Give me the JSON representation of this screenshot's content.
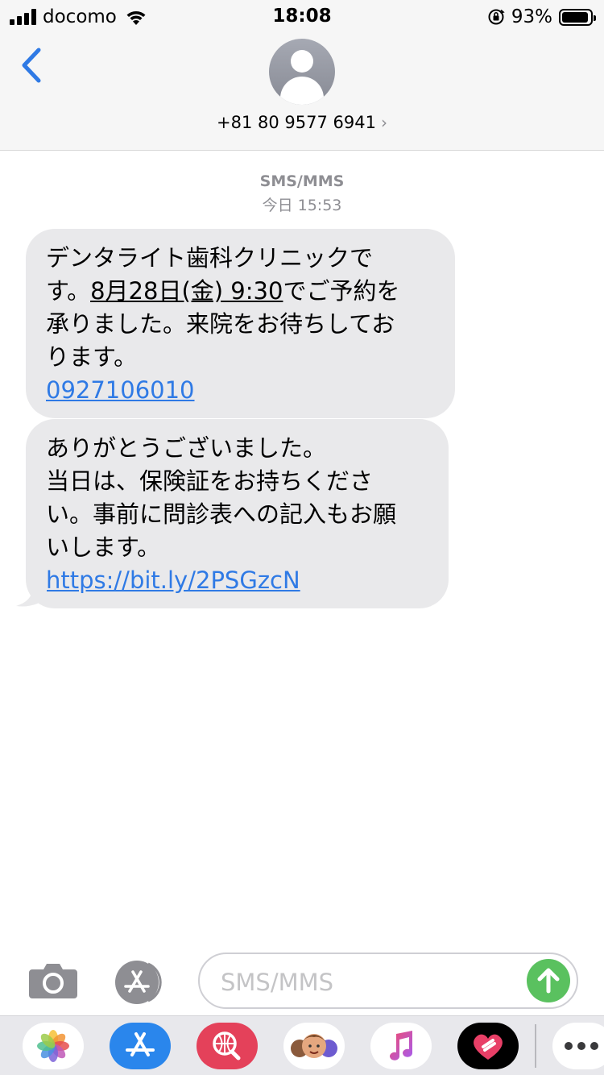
{
  "status": {
    "carrier": "docomo",
    "time": "18:08",
    "battery": "93%",
    "battery_level": 0.93
  },
  "header": {
    "contact": "+81 80 9577 6941",
    "chevron": "›"
  },
  "thread": {
    "service": "SMS/MMS",
    "timestamp": "今日 15:53"
  },
  "messages": [
    {
      "lines": [
        "デンタライト歯科クリニックで"
      ],
      "line2_pre": "す。",
      "line2_date": "8月28日(金) 9:30",
      "line2_post": "でご予約を",
      "line3": "承りました。来院をお待ちしてお",
      "line4": "ります。",
      "link": "0927106010"
    },
    {
      "line1": "ありがとうございました。",
      "line2": "当日は、保険証をお持ちくださ",
      "line3": "い。事前に問診表への記入もお願",
      "line4": "いします。",
      "link": "https://bit.ly/2PSGzcN"
    }
  ],
  "composer": {
    "placeholder": "SMS/MMS"
  },
  "drawer": {
    "apps": [
      "photos-app",
      "app-store-app",
      "web-search-app",
      "memoji-app",
      "music-app",
      "digital-touch-app",
      "more-apps"
    ]
  },
  "colors": {
    "link": "#2f7ae5",
    "bubble": "#e9e9eb",
    "send": "#5ac15f",
    "ios_blue": "#2f7ae5"
  }
}
